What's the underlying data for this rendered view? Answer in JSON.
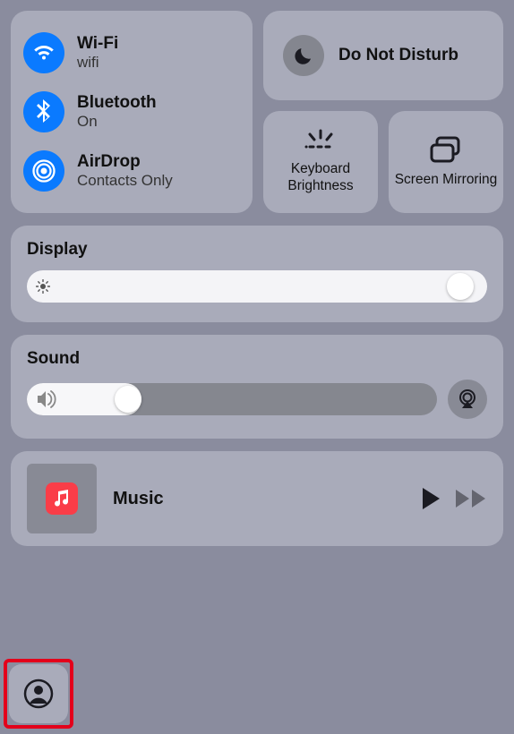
{
  "connectivity": {
    "wifi": {
      "title": "Wi-Fi",
      "sub": "wifi"
    },
    "bluetooth": {
      "title": "Bluetooth",
      "sub": "On"
    },
    "airdrop": {
      "title": "AirDrop",
      "sub": "Contacts Only"
    }
  },
  "dnd": {
    "label": "Do Not Disturb"
  },
  "keyboard": {
    "label": "Keyboard Brightness"
  },
  "mirroring": {
    "label": "Screen Mirroring"
  },
  "display": {
    "label": "Display",
    "value": 97
  },
  "sound": {
    "label": "Sound",
    "value": 20
  },
  "music": {
    "title": "Music"
  },
  "colors": {
    "blue": "#0a7aff",
    "red": "#fa3d48",
    "highlight": "#e3001b"
  }
}
